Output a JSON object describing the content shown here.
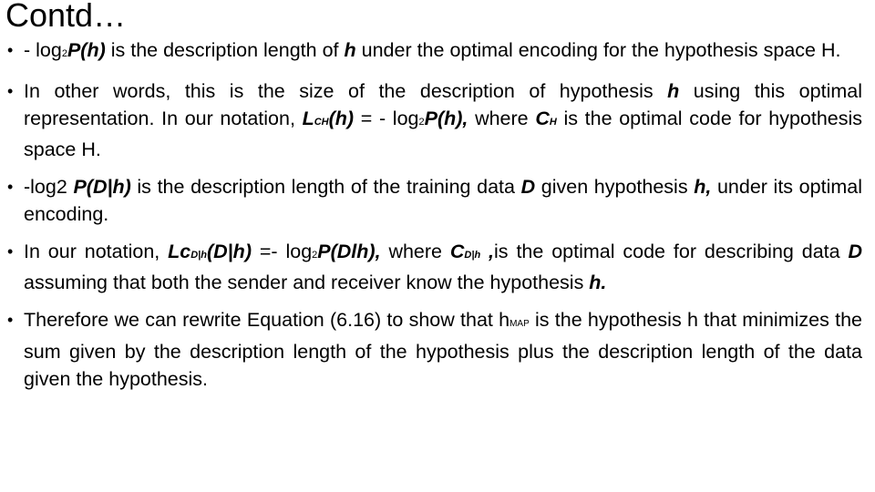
{
  "slide": {
    "title": "Contd…",
    "bullets": [
      {
        "parts": [
          {
            "t": "- log",
            "s": "n"
          },
          {
            "t": "2",
            "s": "sub"
          },
          {
            "t": "P(h)",
            "s": "bi"
          },
          {
            "t": " is the description length of ",
            "s": "n"
          },
          {
            "t": "h",
            "s": "bi"
          },
          {
            "t": " under the optimal encoding for the hypothesis space H.",
            "s": "n"
          }
        ]
      },
      {
        "parts": [
          {
            "t": "In other words, this is the size of the description of hypothesis ",
            "s": "n"
          },
          {
            "t": "h",
            "s": "bi"
          },
          {
            "t": " using this optimal representation. In our notation, ",
            "s": "n"
          },
          {
            "t": "L",
            "s": "bi"
          },
          {
            "t": "CH",
            "s": "subbi"
          },
          {
            "t": "(h)",
            "s": "bi"
          },
          {
            "t": " = - log",
            "s": "n"
          },
          {
            "t": "2",
            "s": "sub"
          },
          {
            "t": "P(h),",
            "s": "bi"
          },
          {
            "t": " where ",
            "s": "n"
          },
          {
            "t": "C",
            "s": "bi"
          },
          {
            "t": "H",
            "s": "subbi"
          },
          {
            "t": " is the optimal code for hypothesis space H.",
            "s": "n"
          }
        ]
      },
      {
        "parts": [
          {
            "t": "-log2 ",
            "s": "n"
          },
          {
            "t": "P(D|h)",
            "s": "bi"
          },
          {
            "t": " is the description length of the training data ",
            "s": "n"
          },
          {
            "t": "D",
            "s": "bi"
          },
          {
            "t": " given hypothesis ",
            "s": "n"
          },
          {
            "t": "h,",
            "s": "bi"
          },
          {
            "t": " under its optimal encoding.",
            "s": "n"
          }
        ]
      },
      {
        "parts": [
          {
            "t": "In our notation, ",
            "s": "n"
          },
          {
            "t": "Lc",
            "s": "bi"
          },
          {
            "t": "D|h",
            "s": "subbi"
          },
          {
            "t": "(D|h)",
            "s": "bi"
          },
          {
            "t": " =- log",
            "s": "n"
          },
          {
            "t": "2",
            "s": "sub"
          },
          {
            "t": "P(Dlh),",
            "s": "bi"
          },
          {
            "t": " where ",
            "s": "n"
          },
          {
            "t": "C",
            "s": "bi"
          },
          {
            "t": "D|h",
            "s": "subbi"
          },
          {
            "t": " ,",
            "s": "bi"
          },
          {
            "t": "is the optimal code for describing data ",
            "s": "n"
          },
          {
            "t": "D",
            "s": "bi"
          },
          {
            "t": " assuming that both the sender and receiver know the hypothesis ",
            "s": "n"
          },
          {
            "t": "h.",
            "s": "bi"
          }
        ]
      },
      {
        "parts": [
          {
            "t": "Therefore we can rewrite Equation (6.16) to show that h",
            "s": "n"
          },
          {
            "t": "MAP",
            "s": "smallcaps"
          },
          {
            "t": " is the hypothesis h that minimizes the sum given by the description length of the hypothesis plus the description length of the data given the hypothesis.",
            "s": "n"
          }
        ]
      }
    ],
    "bullet_glyph": "•"
  }
}
